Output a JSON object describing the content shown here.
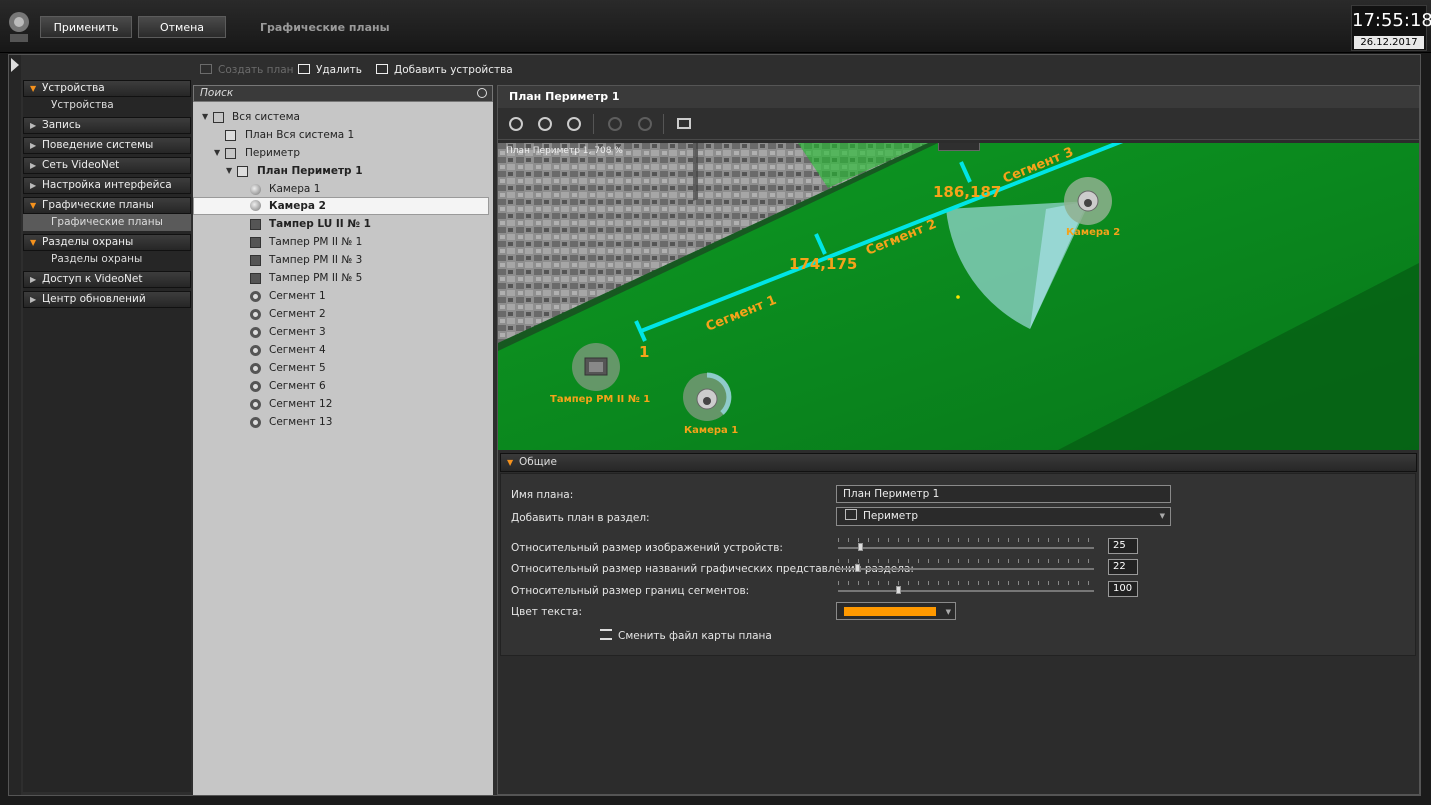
{
  "topbar": {
    "apply_label": "Применить",
    "cancel_label": "Отмена",
    "section_title": "Графические планы",
    "time": "17:55:18",
    "date": "26.12.2017"
  },
  "nav": {
    "items": [
      {
        "label": "Устройства",
        "open": true,
        "children": [
          "Устройства"
        ]
      },
      {
        "label": "Запись"
      },
      {
        "label": "Поведение системы"
      },
      {
        "label": "Сеть VideoNet"
      },
      {
        "label": "Настройка интерфейса"
      },
      {
        "label": "Графические планы",
        "open": true,
        "children": [
          "Графические планы"
        ]
      },
      {
        "label": "Разделы охраны",
        "open": true,
        "children": [
          "Разделы охраны"
        ]
      },
      {
        "label": "Доступ к VideoNet"
      },
      {
        "label": "Центр обновлений"
      }
    ]
  },
  "toolbar": {
    "create_plan": "Создать план",
    "delete": "Удалить",
    "add_devices": "Добавить устройства"
  },
  "tree": {
    "search_placeholder": "Поиск",
    "items": [
      {
        "label": "Вся система",
        "icon": "folder-icon"
      },
      {
        "label": "План Вся система 1",
        "icon": "plan-icon"
      },
      {
        "label": "Периметр",
        "icon": "folder-icon"
      },
      {
        "label": "План Периметр 1",
        "icon": "plan-icon"
      },
      {
        "label": "Камера 1",
        "icon": "camera-icon"
      },
      {
        "label": "Камера 2",
        "icon": "camera-icon"
      },
      {
        "label": "Тампер LU II № 1",
        "icon": "tamper-icon"
      },
      {
        "label": "Тампер РМ II № 1",
        "icon": "tamper-icon"
      },
      {
        "label": "Тампер РМ II № 3",
        "icon": "tamper-icon"
      },
      {
        "label": "Тампер РМ II № 5",
        "icon": "tamper-icon"
      },
      {
        "label": "Сегмент 1",
        "icon": "segment-icon"
      },
      {
        "label": "Сегмент 2",
        "icon": "segment-icon"
      },
      {
        "label": "Сегмент 3",
        "icon": "segment-icon"
      },
      {
        "label": "Сегмент 4",
        "icon": "segment-icon"
      },
      {
        "label": "Сегмент 5",
        "icon": "segment-icon"
      },
      {
        "label": "Сегмент 6",
        "icon": "segment-icon"
      },
      {
        "label": "Сегмент 12",
        "icon": "segment-icon"
      },
      {
        "label": "Сегмент 13",
        "icon": "segment-icon"
      }
    ]
  },
  "plan": {
    "title": "План Периметр 1",
    "zoom_label": "План Периметр 1, 708 %",
    "map": {
      "segments": [
        "Сегмент 1",
        "Сегмент 2",
        "Сегмент 3"
      ],
      "markers": [
        "1",
        "174,175",
        "186,187"
      ],
      "devices": [
        "Тампер РМ II № 1",
        "Камера 1",
        "Камера 2"
      ],
      "line_color": "#00e5e5",
      "label_color": "#f5a31a"
    }
  },
  "general": {
    "header": "Общие",
    "plan_name_label": "Имя плана:",
    "plan_name_value": "План Периметр 1",
    "section_label": "Добавить план в раздел:",
    "section_value": "Периметр",
    "sliders": [
      {
        "label": "Относительный размер изображений устройств:",
        "value": "25"
      },
      {
        "label": "Относительный размер названий графических представлений раздела:",
        "value": "22"
      },
      {
        "label": "Относительный размер границ сегментов:",
        "value": "100"
      }
    ],
    "text_color_label": "Цвет текста:",
    "text_color": "#ff9900",
    "change_map_label": "Сменить файл карты плана"
  }
}
